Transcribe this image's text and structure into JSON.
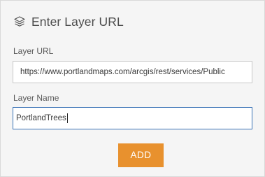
{
  "header": {
    "icon": "layers-icon",
    "title": "Enter Layer URL"
  },
  "form": {
    "url_label": "Layer URL",
    "url_value": "https://www.portlandmaps.com/arcgis/rest/services/Public",
    "name_label": "Layer Name",
    "name_value": "PortlandTrees",
    "add_label": "ADD"
  },
  "colors": {
    "panel_bg": "#f5f5f5",
    "accent": "#e8912e",
    "focus_border": "#3a72b5"
  }
}
